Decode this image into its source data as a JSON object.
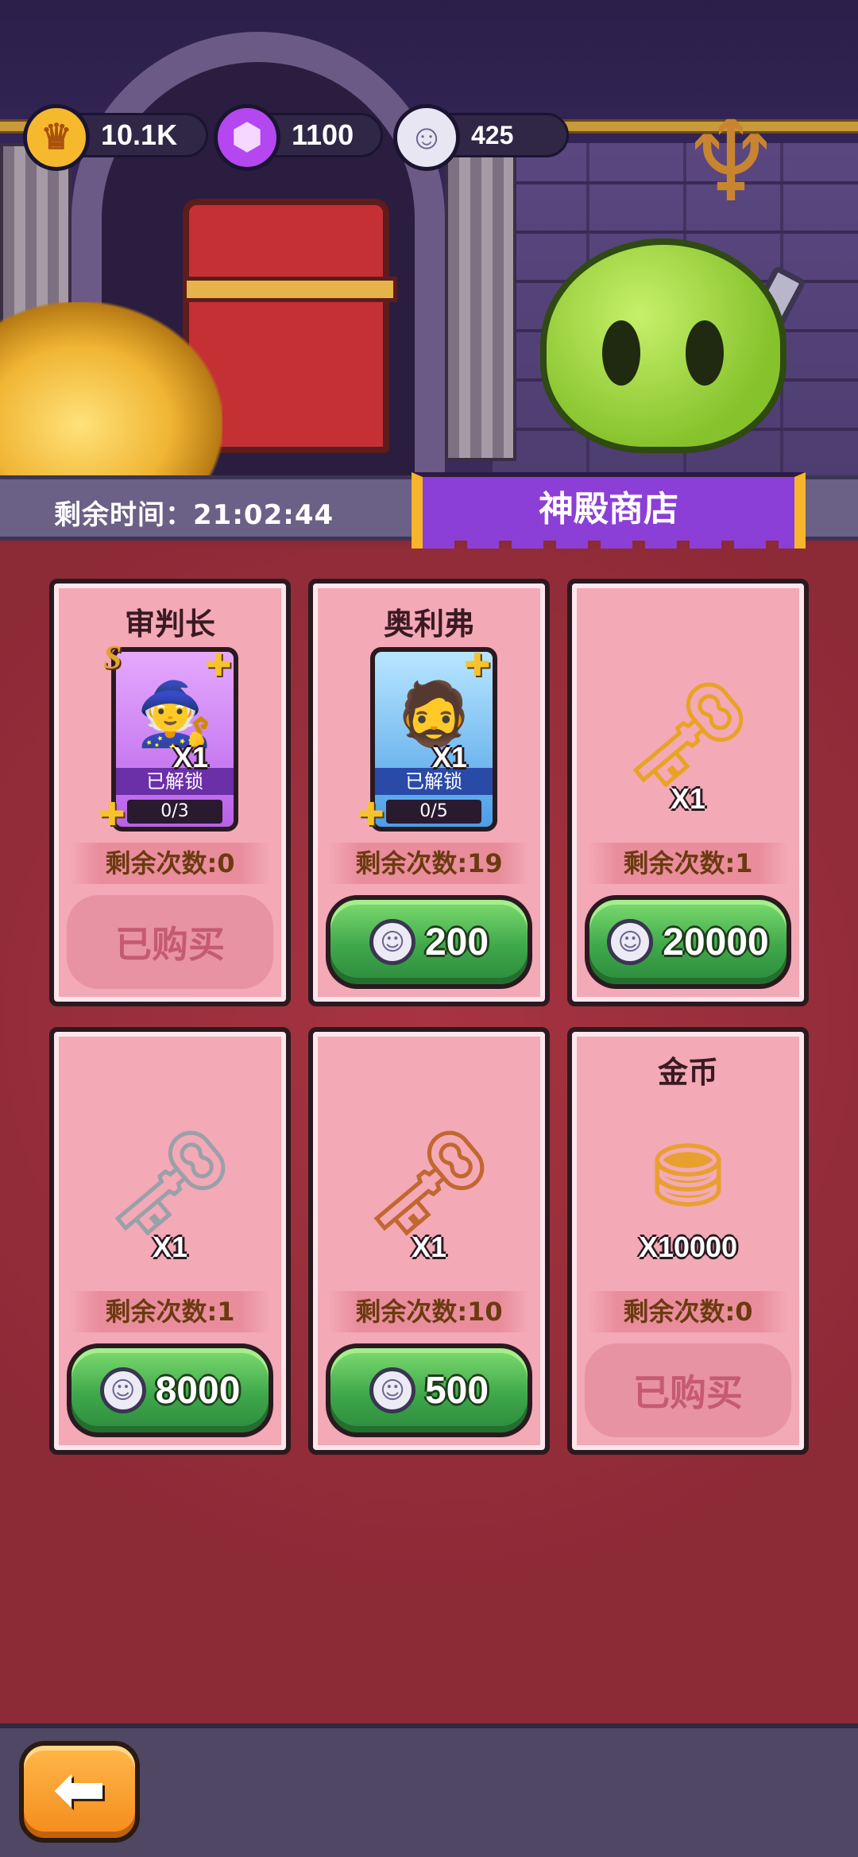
{
  "currency": {
    "gold": {
      "value": "10.1K",
      "icon": "crown-coin-icon"
    },
    "gem": {
      "value": "1100",
      "icon": "purple-gem-icon"
    },
    "soul": {
      "value": "425",
      "icon": "soul-token-icon"
    }
  },
  "header": {
    "timer_label": "剩余时间：21:02:44",
    "shop_title": "神殿商店"
  },
  "items": [
    {
      "name": "审判长",
      "kind": "hero-card",
      "rank": "S",
      "qty": "X1",
      "unlock": "已解锁",
      "progress": "0/3",
      "remain_label": "剩余次数:0",
      "status": "bought",
      "bought_label": "已购买"
    },
    {
      "name": "奥利弗",
      "kind": "hero-card",
      "qty": "X1",
      "unlock": "已解锁",
      "progress": "0/5",
      "remain_label": "剩余次数:19",
      "status": "buy",
      "price": "200"
    },
    {
      "name": "",
      "kind": "ruby-key",
      "qty": "X1",
      "remain_label": "剩余次数:1",
      "status": "buy",
      "price": "20000"
    },
    {
      "name": "",
      "kind": "silver-key",
      "qty": "X1",
      "remain_label": "剩余次数:1",
      "status": "buy",
      "price": "8000"
    },
    {
      "name": "",
      "kind": "bronze-key",
      "qty": "X1",
      "remain_label": "剩余次数:10",
      "status": "buy",
      "price": "500"
    },
    {
      "name": "金币",
      "kind": "gold-coins",
      "qty": "X10000",
      "remain_label": "剩余次数:0",
      "status": "bought",
      "bought_label": "已购买"
    }
  ],
  "colors": {
    "accent_purple": "#8b3fd6",
    "buy_green": "#3fa84b",
    "bg_red": "#8c2a36"
  },
  "nav": {
    "back_icon": "arrow-left-icon"
  }
}
